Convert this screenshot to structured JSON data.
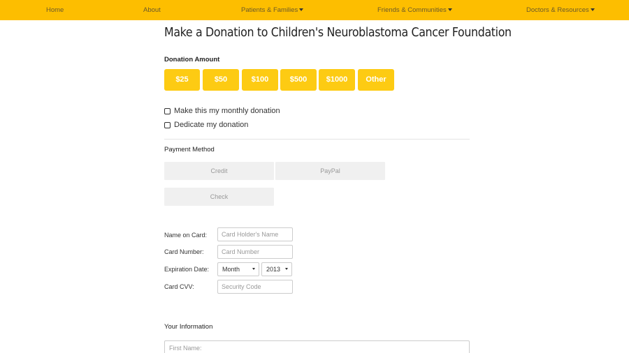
{
  "nav": {
    "home": "Home",
    "about": "About",
    "patients": "Patients & Families",
    "friends": "Friends & Communities",
    "doctors": "Doctors & Resources"
  },
  "page": {
    "title": "Make a Donation to Children's Neuroblastoma Cancer Foundation"
  },
  "donation": {
    "label": "Donation Amount",
    "amounts": [
      "$25",
      "$50",
      "$100",
      "$500",
      "$1000",
      "Other"
    ],
    "monthly_label": "Make this my monthly donation",
    "dedicate_label": "Dedicate my donation"
  },
  "payment": {
    "label": "Payment Method",
    "credit": "Credit",
    "paypal": "PayPal",
    "check": "Check"
  },
  "card": {
    "name_label": "Name on Card:",
    "name_placeholder": "Card Holder's Name",
    "number_label": "Card Number:",
    "number_placeholder": "Card Number",
    "exp_label": "Expiration Date:",
    "month_value": "Month",
    "year_value": "2013",
    "cvv_label": "Card CVV:",
    "cvv_placeholder": "Security Code"
  },
  "info": {
    "label": "Your Information",
    "first_name_placeholder": "First Name:"
  },
  "colors": {
    "nav_bg": "#fdbe00",
    "button_bg": "#fdcb13",
    "payment_btn_bg": "#f0f0f0"
  }
}
